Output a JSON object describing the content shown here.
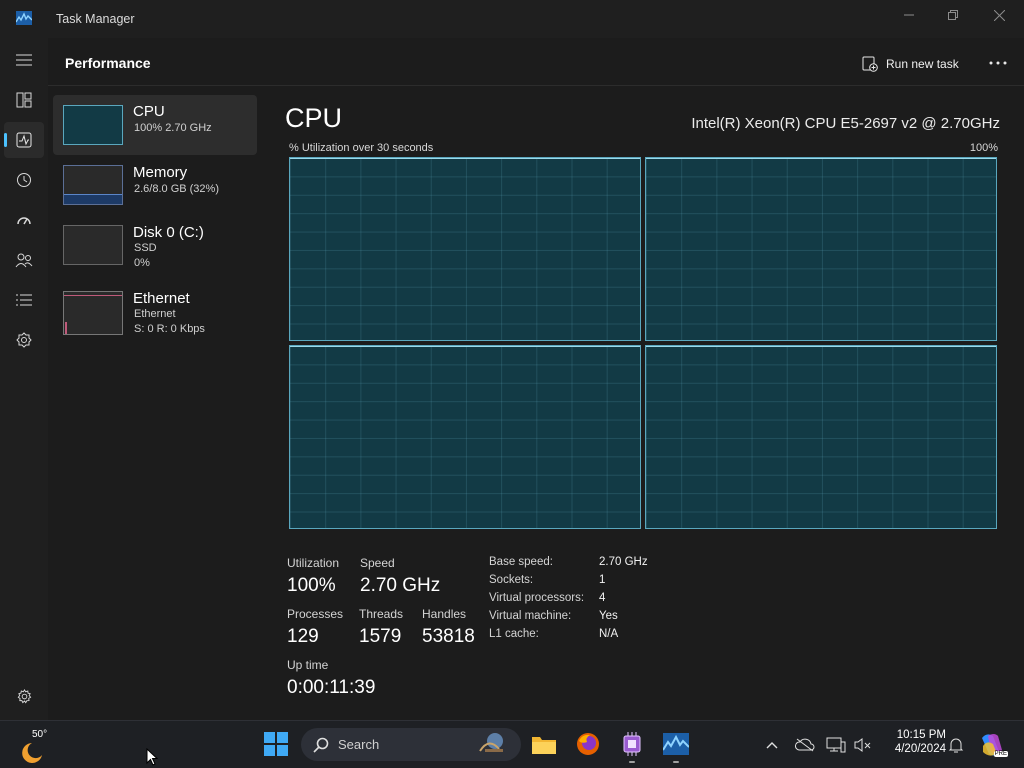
{
  "window": {
    "title": "Task Manager"
  },
  "header": {
    "title": "Performance",
    "run_new_task": "Run new task"
  },
  "resources": [
    {
      "name": "CPU",
      "sub1": "100%  2.70 GHz"
    },
    {
      "name": "Memory",
      "sub1": "2.6/8.0 GB (32%)"
    },
    {
      "name": "Disk 0 (C:)",
      "sub1": "SSD",
      "sub2": "0%"
    },
    {
      "name": "Ethernet",
      "sub1": "Ethernet",
      "sub2": "S: 0  R: 0 Kbps"
    }
  ],
  "cpu": {
    "title": "CPU",
    "model": "Intel(R) Xeon(R) CPU E5-2697 v2 @ 2.70GHz",
    "graph_label": "% Utilization over 30 seconds",
    "graph_max": "100%",
    "cores_graphed": 4,
    "stats": {
      "utilization_label": "Utilization",
      "utilization": "100%",
      "speed_label": "Speed",
      "speed": "2.70 GHz",
      "processes_label": "Processes",
      "processes": "129",
      "threads_label": "Threads",
      "threads": "1579",
      "handles_label": "Handles",
      "handles": "53818",
      "uptime_label": "Up time",
      "uptime": "0:00:11:39"
    },
    "details": [
      {
        "label": "Base speed:",
        "value": "2.70 GHz"
      },
      {
        "label": "Sockets:",
        "value": "1"
      },
      {
        "label": "Virtual processors:",
        "value": "4"
      },
      {
        "label": "Virtual machine:",
        "value": "Yes"
      },
      {
        "label": "L1 cache:",
        "value": "N/A"
      }
    ]
  },
  "taskbar": {
    "weather_temp": "50°",
    "search_placeholder": "Search",
    "time": "10:15 PM",
    "date": "4/20/2024",
    "copilot_badge": "PRE"
  },
  "colors": {
    "accent": "#4cc2ff",
    "graph_fill": "#123a45",
    "graph_line": "#5aa7be"
  }
}
